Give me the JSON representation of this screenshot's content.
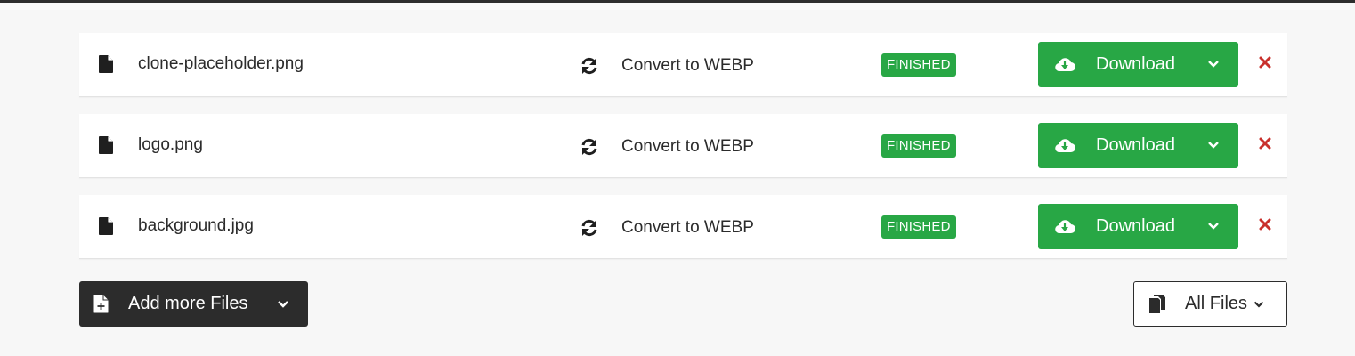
{
  "theme": {
    "accent": "#28a745",
    "dark": "#2c2c2c",
    "danger": "#c9302c"
  },
  "files": [
    {
      "name": "clone-placeholder.png",
      "conversion": "Convert to WEBP",
      "status": "FINISHED",
      "download_label": "Download",
      "icon": "file-icon"
    },
    {
      "name": "logo.png",
      "conversion": "Convert to WEBP",
      "status": "FINISHED",
      "download_label": "Download",
      "icon": "file-icon"
    },
    {
      "name": "background.jpg",
      "conversion": "Convert to WEBP",
      "status": "FINISHED",
      "download_label": "Download",
      "icon": "file-icon"
    }
  ],
  "actions": {
    "add_more_label": "Add more Files",
    "all_files_label": "All Files"
  }
}
